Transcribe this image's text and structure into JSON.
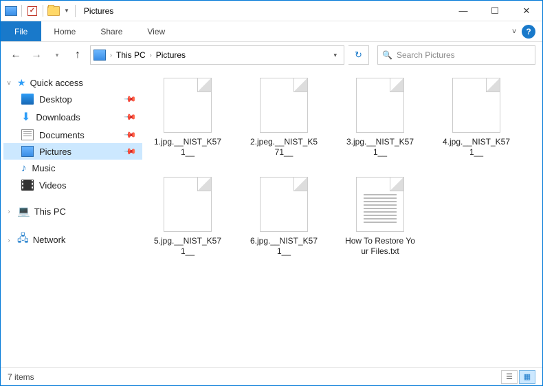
{
  "window": {
    "title": "Pictures"
  },
  "ribbon": {
    "file": "File",
    "tabs": [
      "Home",
      "Share",
      "View"
    ]
  },
  "breadcrumb": {
    "root": "This PC",
    "current": "Pictures"
  },
  "search": {
    "placeholder": "Search Pictures"
  },
  "sidebar": {
    "quick_access": "Quick access",
    "items": [
      {
        "label": "Desktop",
        "icon": "desktop",
        "pinned": true
      },
      {
        "label": "Downloads",
        "icon": "downloads",
        "pinned": true
      },
      {
        "label": "Documents",
        "icon": "documents",
        "pinned": true
      },
      {
        "label": "Pictures",
        "icon": "pictures",
        "pinned": true,
        "selected": true
      },
      {
        "label": "Music",
        "icon": "music",
        "pinned": false
      },
      {
        "label": "Videos",
        "icon": "videos",
        "pinned": false
      }
    ],
    "this_pc": "This PC",
    "network": "Network"
  },
  "files": [
    {
      "name": "1.jpg.__NIST_K571__",
      "type": "blank"
    },
    {
      "name": "2.jpeg.__NIST_K571__",
      "type": "blank"
    },
    {
      "name": "3.jpg.__NIST_K571__",
      "type": "blank"
    },
    {
      "name": "4.jpg.__NIST_K571__",
      "type": "blank"
    },
    {
      "name": "5.jpg.__NIST_K571__",
      "type": "blank"
    },
    {
      "name": "6.jpg.__NIST_K571__",
      "type": "blank"
    },
    {
      "name": "How To Restore Your Files.txt",
      "type": "txt"
    }
  ],
  "status": {
    "count": "7 items"
  }
}
